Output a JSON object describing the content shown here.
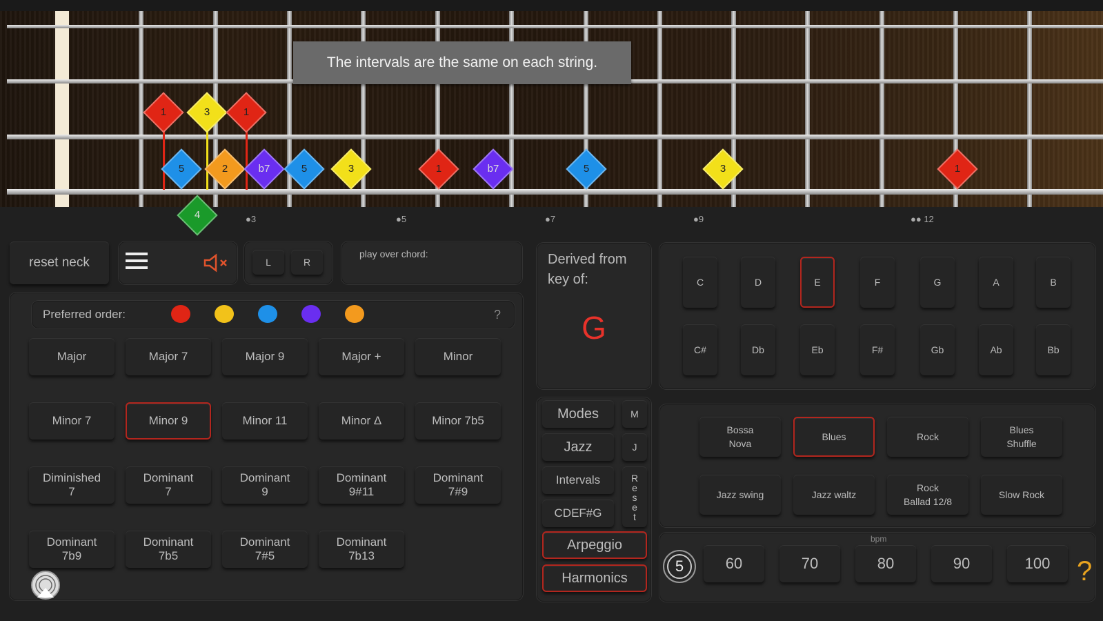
{
  "neck": {
    "tooltip": "The intervals are the same on each string.",
    "fret_markers": [
      {
        "label": "●3",
        "fret": 3
      },
      {
        "label": "●5",
        "fret": 5
      },
      {
        "label": "●7",
        "fret": 7
      },
      {
        "label": "●9",
        "fret": 9
      },
      {
        "label": "●● 12",
        "fret": 12
      }
    ],
    "notes": [
      {
        "label": "1",
        "color": "#e02515",
        "string": 3,
        "fret": 2
      },
      {
        "label": "3",
        "color": "#f2e01a",
        "string": 3,
        "fret": 3
      },
      {
        "label": "1",
        "color": "#e02515",
        "string": 3,
        "fret": 4
      },
      {
        "label": "5",
        "color": "#1e90e8",
        "string": 4,
        "fret": 2
      },
      {
        "label": "2",
        "color": "#f39a1e",
        "string": 4,
        "fret": 3
      },
      {
        "label": "b7",
        "color": "#6a2ef0",
        "string": 4,
        "fret": 4
      },
      {
        "label": "5",
        "color": "#1e90e8",
        "string": 4,
        "fret": 5
      },
      {
        "label": "3",
        "color": "#f2e01a",
        "string": 4,
        "fret": 6
      },
      {
        "label": "1",
        "color": "#e02515",
        "string": 4,
        "fret": 7
      },
      {
        "label": "b7",
        "color": "#6a2ef0",
        "string": 4,
        "fret": 8
      },
      {
        "label": "5",
        "color": "#1e90e8",
        "string": 4,
        "fret": 9
      },
      {
        "label": "3",
        "color": "#f2e01a",
        "string": 4,
        "fret": 11
      },
      {
        "label": "1",
        "color": "#e02515",
        "string": 4,
        "fret": 14
      },
      {
        "label": "4",
        "color": "#1a9a2a",
        "string": 5,
        "fret": 3
      }
    ]
  },
  "toolbar": {
    "reset_neck": "reset neck",
    "left": "L",
    "right": "R",
    "play_over_chord": "play over chord:",
    "menu_icon": "menu-icon",
    "mute_icon": "speaker-muted-icon"
  },
  "preferred": {
    "label": "Preferred order:",
    "help": "?",
    "colors": [
      "#e02515",
      "#f2c21a",
      "#1e90e8",
      "#6a2ef0",
      "#f39a1e"
    ]
  },
  "chords": [
    "Major",
    "Major 7",
    "Major 9",
    "Major +",
    "Minor",
    "Minor 7",
    "Minor 9",
    "Minor 11",
    "Minor Δ",
    "Minor 7b5",
    "Diminished\n7",
    "Dominant\n7",
    "Dominant\n9",
    "Dominant\n9#11",
    "Dominant\n7#9",
    "Dominant\n7b9",
    "Dominant\n7b5",
    "Dominant\n7#5",
    "Dominant\n7b13"
  ],
  "selected_chord": "Minor 9",
  "derived": {
    "label": "Derived from key of:",
    "key": "G",
    "key_color": "#e8322a"
  },
  "keys_natural": [
    "C",
    "D",
    "E",
    "F",
    "G",
    "A",
    "B"
  ],
  "keys_accidental": [
    "C#",
    "Db",
    "Eb",
    "F#",
    "Gb",
    "Ab",
    "Bb"
  ],
  "selected_key": "E",
  "modes": {
    "modes": "Modes",
    "m": "M",
    "jazz": "Jazz",
    "j": "J",
    "intervals": "Intervals",
    "reset": "Reset",
    "cdefg": "CDEF#G",
    "arpeggio": "Arpeggio",
    "harmonics": "Harmonics"
  },
  "styles": [
    "Bossa\nNova",
    "Blues",
    "Rock",
    "Blues\nShuffle",
    "Jazz swing",
    "Jazz waltz",
    "Rock\nBallad 12/8",
    "Slow Rock"
  ],
  "selected_style": "Blues",
  "bpm": {
    "label": "bpm",
    "values": [
      "60",
      "70",
      "80",
      "90",
      "100"
    ],
    "count": "5",
    "help": "?"
  }
}
